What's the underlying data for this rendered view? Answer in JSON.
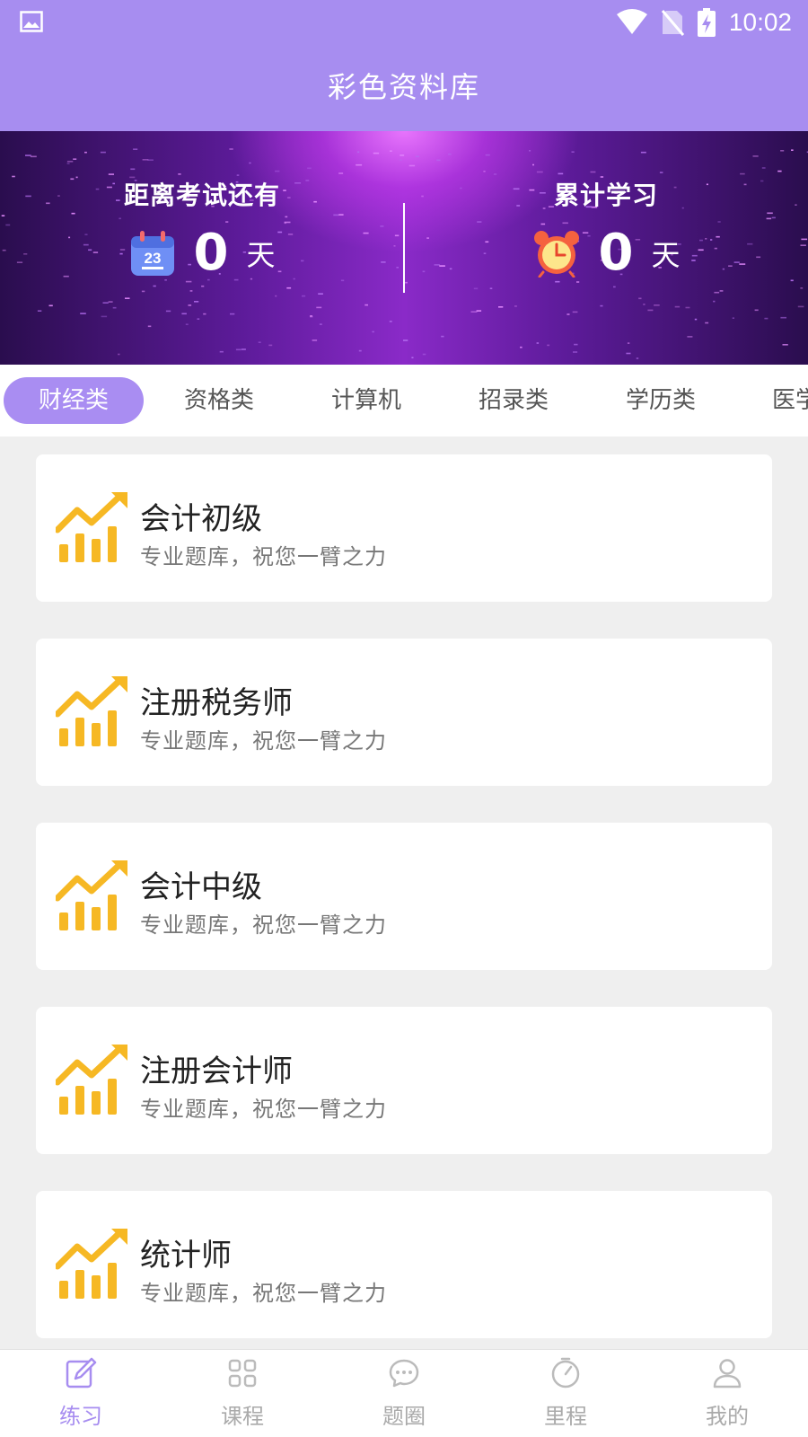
{
  "status": {
    "time": "10:02",
    "icons": [
      "image-icon",
      "wifi-icon",
      "no-sim-icon",
      "battery-charging-icon"
    ]
  },
  "header": {
    "title": "彩色资料库"
  },
  "banner": {
    "left": {
      "label": "距离考试还有",
      "value": "0",
      "unit": "天",
      "icon": "calendar-icon"
    },
    "right": {
      "label": "累计学习",
      "value": "0",
      "unit": "天",
      "icon": "alarm-clock-icon"
    }
  },
  "tabs": [
    {
      "label": "财经类",
      "active": true
    },
    {
      "label": "资格类"
    },
    {
      "label": "计算机"
    },
    {
      "label": "招录类"
    },
    {
      "label": "学历类"
    },
    {
      "label": "医学"
    }
  ],
  "cards": [
    {
      "name": "会计初级",
      "desc": "专业题库，祝您一臂之力"
    },
    {
      "name": "注册税务师",
      "desc": "专业题库，祝您一臂之力"
    },
    {
      "name": "会计中级",
      "desc": "专业题库，祝您一臂之力"
    },
    {
      "name": "注册会计师",
      "desc": "专业题库，祝您一臂之力"
    },
    {
      "name": "统计师",
      "desc": "专业题库，祝您一臂之力"
    }
  ],
  "nav": [
    {
      "label": "练习",
      "icon": "edit-icon",
      "active": true
    },
    {
      "label": "课程",
      "icon": "grid-icon"
    },
    {
      "label": "题圈",
      "icon": "chat-bubble-icon"
    },
    {
      "label": "里程",
      "icon": "timer-icon"
    },
    {
      "label": "我的",
      "icon": "user-icon"
    }
  ],
  "colors": {
    "accent": "#a78df0",
    "chart_icon": "#f6b824",
    "banner_dark": "#2a0d4e"
  }
}
